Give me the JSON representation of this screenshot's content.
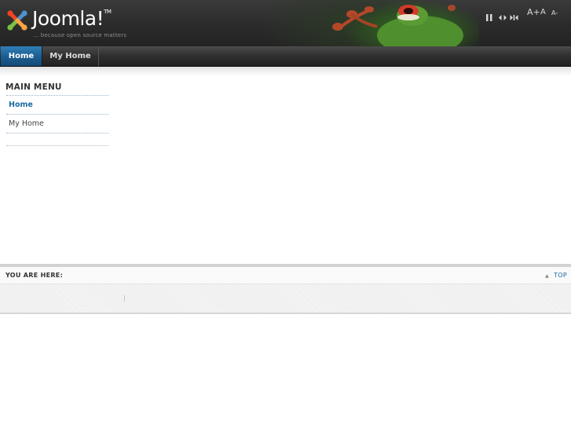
{
  "header": {
    "logo_text": "Joomla!",
    "logo_tm": "TM",
    "tagline": "... because open source matters",
    "tools": {
      "pause_icon": "pause-icon",
      "width_narrow_icon": "narrow-width-icon",
      "width_wide_icon": "wide-width-icon",
      "font_increase": "A+",
      "font_reset": "A",
      "font_decrease": "A-"
    }
  },
  "nav": {
    "items": [
      {
        "label": "Home",
        "active": true
      },
      {
        "label": "My Home",
        "active": false
      }
    ]
  },
  "main_menu": {
    "title": "MAIN MENU",
    "items": [
      {
        "label": "Home",
        "active": true
      },
      {
        "label": "My Home",
        "active": false
      }
    ]
  },
  "breadcrumb": {
    "label": "YOU ARE HERE:",
    "top_link": "TOP"
  },
  "colors": {
    "accent": "#1b6aa1",
    "nav_active": "#1c5f93",
    "header_bg": "#2b2b2b"
  }
}
